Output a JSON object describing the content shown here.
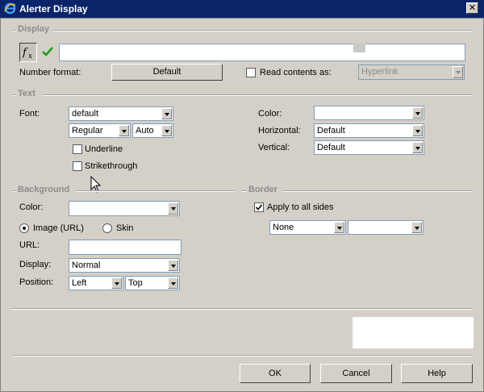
{
  "window": {
    "title": "Alerter Display",
    "close_glyph": "✕"
  },
  "display": {
    "section": "Display",
    "fx_icon": "function-icon",
    "check_icon": "checkmark-icon",
    "expression_value": "",
    "number_format_label": "Number format:",
    "number_format_button": "Default",
    "read_contents_label": "Read contents as:",
    "read_contents_checked": false,
    "read_contents_value": "Hyperlink"
  },
  "text": {
    "section": "Text",
    "font_label": "Font:",
    "font_value": "default",
    "style_value": "Regular",
    "size_value": "Auto",
    "underline_label": "Underline",
    "strikethrough_label": "Strikethrough",
    "color_label": "Color:",
    "color_value": "",
    "horizontal_label": "Horizontal:",
    "horizontal_value": "Default",
    "vertical_label": "Vertical:",
    "vertical_value": "Default"
  },
  "background": {
    "section": "Background",
    "color_label": "Color:",
    "color_value": "",
    "image_label": "Image (URL)",
    "skin_label": "Skin",
    "url_label": "URL:",
    "url_value": "",
    "display_label": "Display:",
    "display_value": "Normal",
    "position_label": "Position:",
    "position_h": "Left",
    "position_v": "Top"
  },
  "border": {
    "section": "Border",
    "apply_all_label": "Apply to all sides",
    "apply_all_checked": true,
    "style_value": "None",
    "color_value": ""
  },
  "buttons": {
    "ok": "OK",
    "cancel": "Cancel",
    "help": "Help"
  }
}
